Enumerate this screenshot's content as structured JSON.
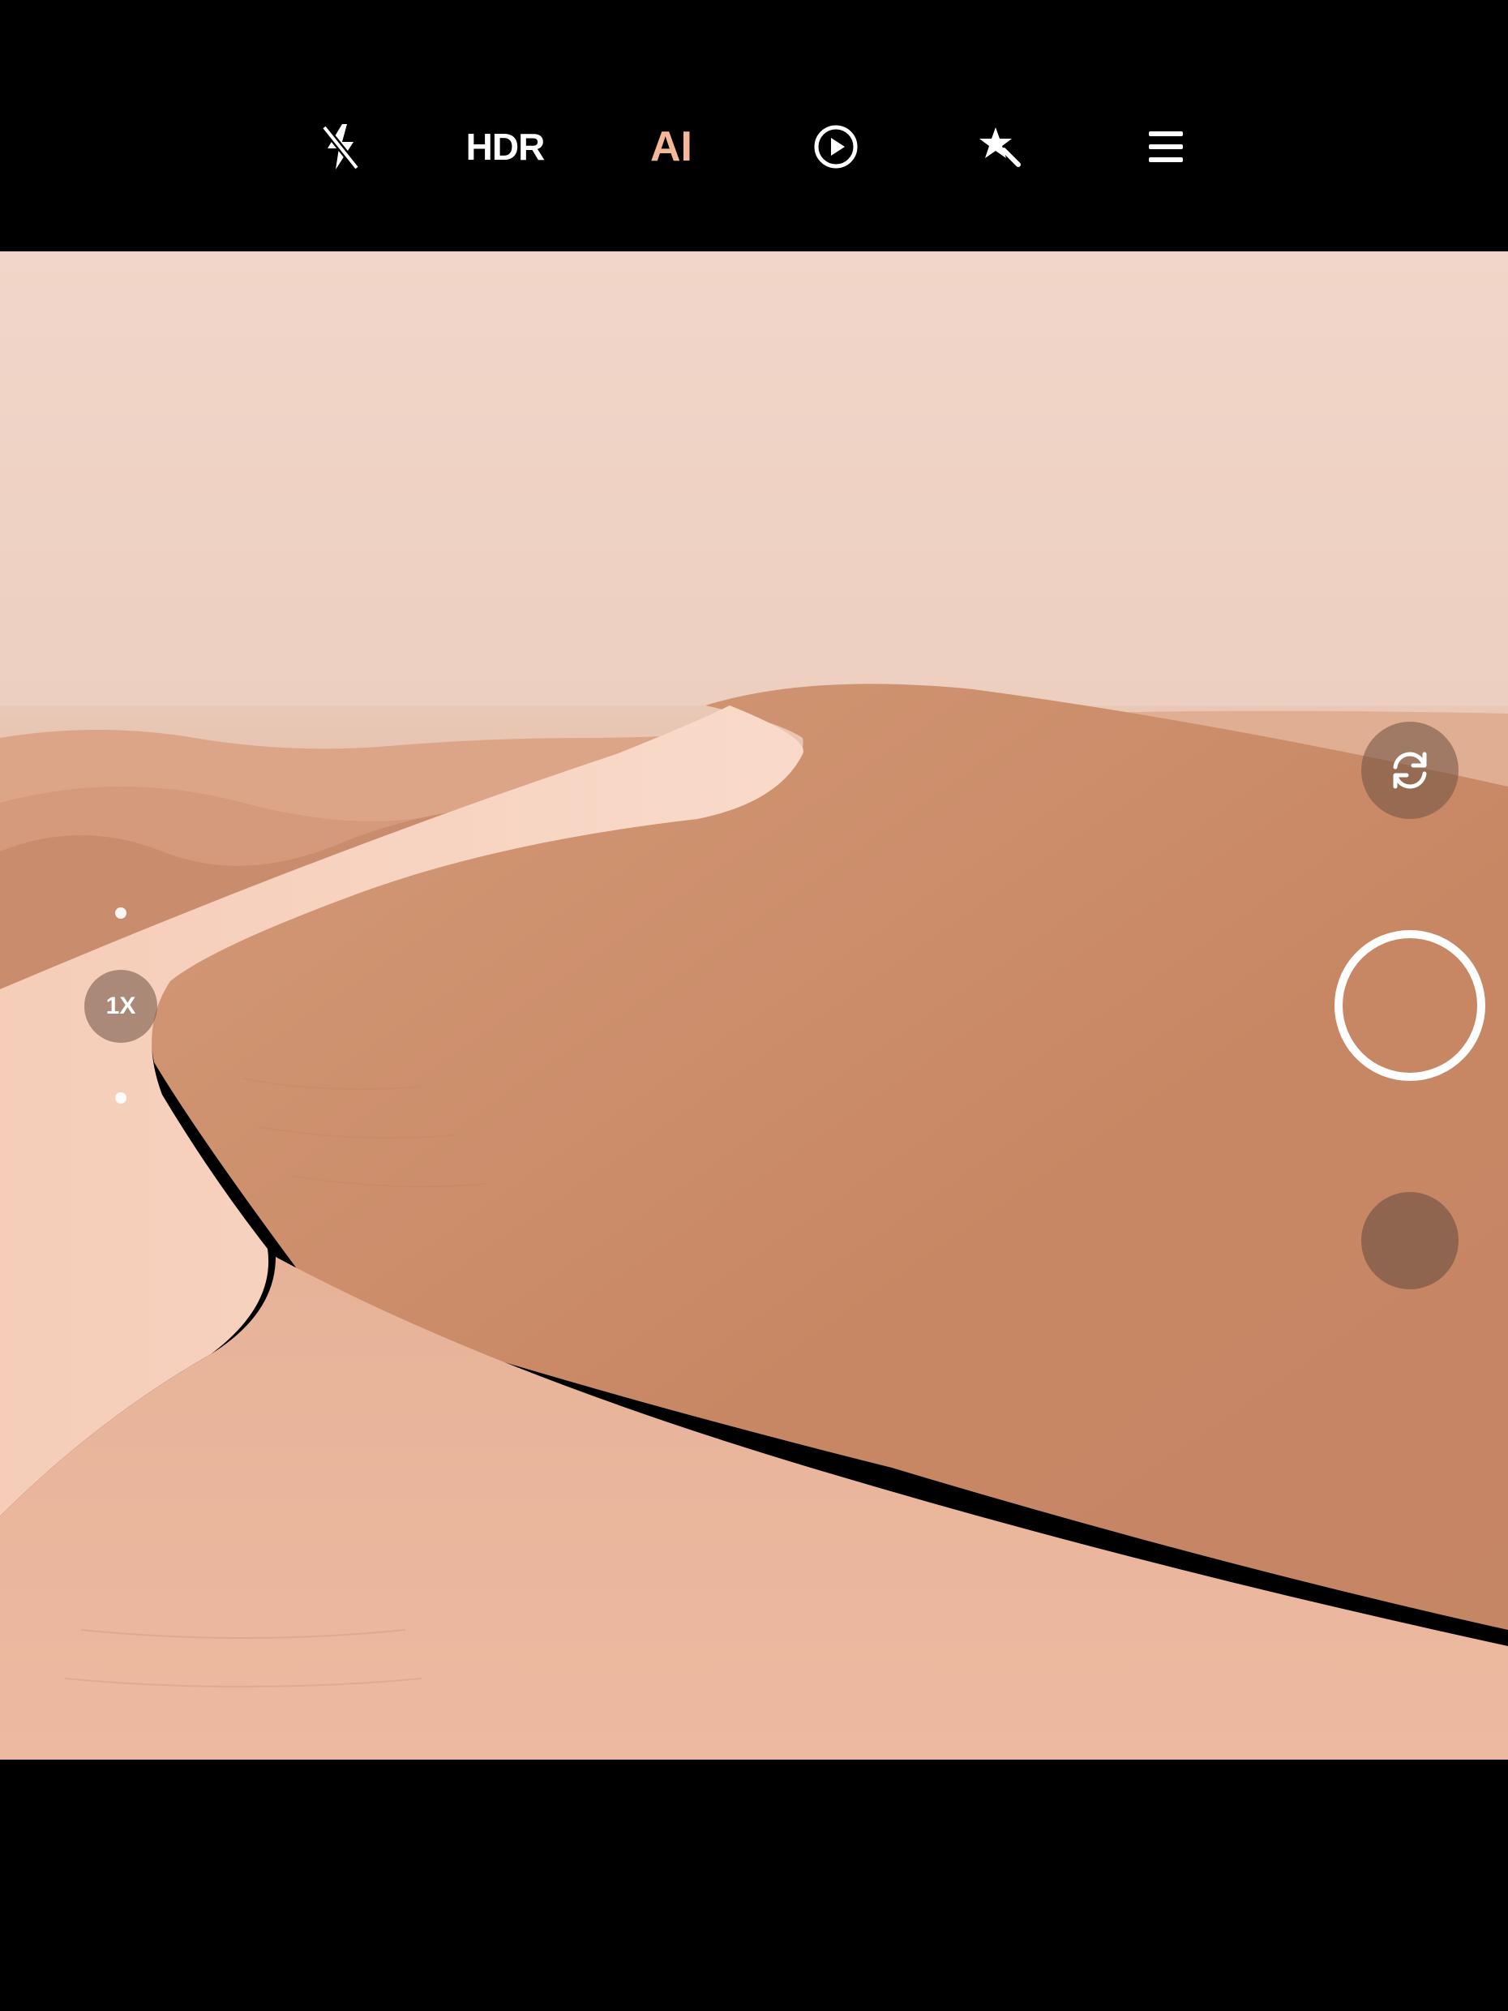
{
  "camera": {
    "topbar": {
      "flash": {
        "icon": "flash-off-icon",
        "state": "off"
      },
      "hdr_label": "HDR",
      "ai_label": "AI",
      "live": {
        "icon": "play-circle-icon"
      },
      "filters": {
        "icon": "sparkle-wand-icon"
      },
      "menu": {
        "icon": "hamburger-menu-icon"
      }
    },
    "zoom": {
      "label": "1X"
    },
    "controls": {
      "switch_camera": {
        "icon": "camera-switch-icon"
      },
      "shutter": {
        "icon": "shutter-ring"
      },
      "gallery": {
        "icon": "gallery-thumbnail"
      }
    },
    "colors": {
      "bar_background": "#000000",
      "ai_accent": "#F5B999",
      "icon_white": "#FFFFFF",
      "sky": "#EFD3C5",
      "dune_shadow": "#C98A68",
      "dune_light": "#F3C8B2"
    }
  }
}
